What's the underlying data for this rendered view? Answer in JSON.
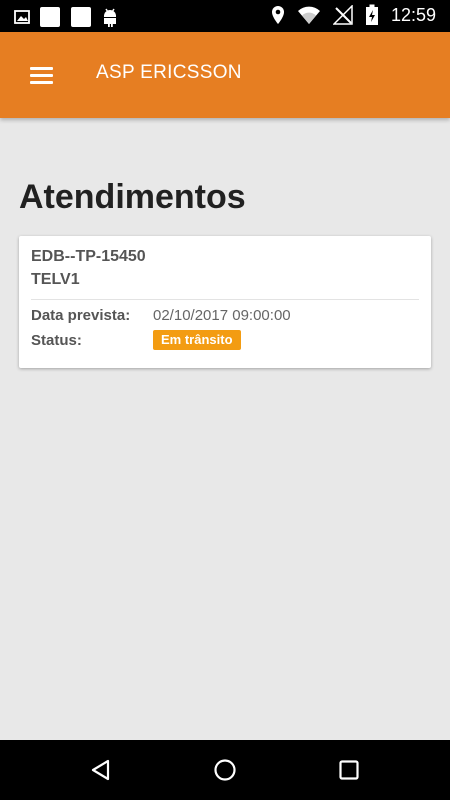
{
  "status_bar": {
    "time": "12:59"
  },
  "app_bar": {
    "title": "ASP ERICSSON"
  },
  "page": {
    "title": "Atendimentos"
  },
  "cards": [
    {
      "code": "EDB--TP-15450",
      "code2": "TELV1",
      "expected_label": "Data prevista:",
      "expected_value": "02/10/2017 09:00:00",
      "status_label": "Status:",
      "status_value": "Em trânsito"
    }
  ],
  "colors": {
    "primary": "#e67e22",
    "badge": "#f39c12"
  }
}
